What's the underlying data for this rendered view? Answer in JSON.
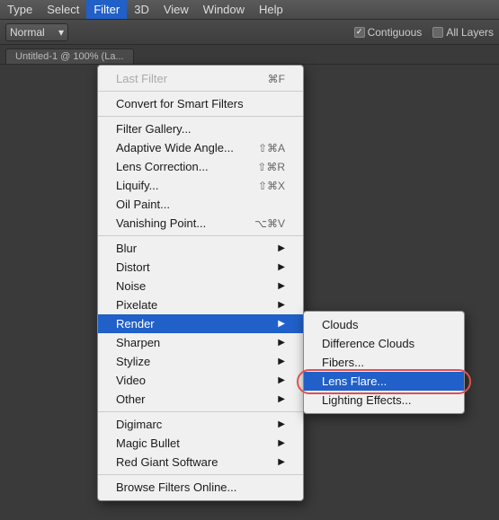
{
  "menubar": {
    "items": [
      {
        "label": "Type",
        "active": false
      },
      {
        "label": "Select",
        "active": false
      },
      {
        "label": "Filter",
        "active": true
      },
      {
        "label": "3D",
        "active": false
      },
      {
        "label": "View",
        "active": false
      },
      {
        "label": "Window",
        "active": false
      },
      {
        "label": "Help",
        "active": false
      }
    ]
  },
  "optionsbar": {
    "blend_mode": "Normal",
    "contiguous_label": "Contiguous",
    "all_layers_label": "All Layers"
  },
  "tab": {
    "label": "Untitled-1 @ 100% (La..."
  },
  "filter_menu": {
    "items": [
      {
        "label": "Last Filter",
        "shortcut": "⌘F",
        "disabled": true,
        "has_submenu": false
      },
      {
        "label": "",
        "separator": true
      },
      {
        "label": "Convert for Smart Filters",
        "shortcut": "",
        "disabled": false,
        "has_submenu": false
      },
      {
        "label": "",
        "separator": true
      },
      {
        "label": "Filter Gallery...",
        "shortcut": "",
        "disabled": false,
        "has_submenu": false
      },
      {
        "label": "Adaptive Wide Angle...",
        "shortcut": "⇧⌘A",
        "disabled": false,
        "has_submenu": false
      },
      {
        "label": "Lens Correction...",
        "shortcut": "⇧⌘R",
        "disabled": false,
        "has_submenu": false
      },
      {
        "label": "Liquify...",
        "shortcut": "⇧⌘X",
        "disabled": false,
        "has_submenu": false
      },
      {
        "label": "Oil Paint...",
        "shortcut": "",
        "disabled": false,
        "has_submenu": false
      },
      {
        "label": "Vanishing Point...",
        "shortcut": "⌥⌘V",
        "disabled": false,
        "has_submenu": false
      },
      {
        "label": "",
        "separator": true
      },
      {
        "label": "Blur",
        "shortcut": "",
        "disabled": false,
        "has_submenu": true
      },
      {
        "label": "Distort",
        "shortcut": "",
        "disabled": false,
        "has_submenu": true
      },
      {
        "label": "Noise",
        "shortcut": "",
        "disabled": false,
        "has_submenu": true
      },
      {
        "label": "Pixelate",
        "shortcut": "",
        "disabled": false,
        "has_submenu": true
      },
      {
        "label": "Render",
        "shortcut": "",
        "disabled": false,
        "has_submenu": true,
        "highlighted": true
      },
      {
        "label": "Sharpen",
        "shortcut": "",
        "disabled": false,
        "has_submenu": true
      },
      {
        "label": "Stylize",
        "shortcut": "",
        "disabled": false,
        "has_submenu": true
      },
      {
        "label": "Video",
        "shortcut": "",
        "disabled": false,
        "has_submenu": true
      },
      {
        "label": "Other",
        "shortcut": "",
        "disabled": false,
        "has_submenu": true
      },
      {
        "label": "",
        "separator": true
      },
      {
        "label": "Digimarc",
        "shortcut": "",
        "disabled": false,
        "has_submenu": true
      },
      {
        "label": "Magic Bullet",
        "shortcut": "",
        "disabled": false,
        "has_submenu": true
      },
      {
        "label": "Red Giant Software",
        "shortcut": "",
        "disabled": false,
        "has_submenu": true
      },
      {
        "label": "",
        "separator": true
      },
      {
        "label": "Browse Filters Online...",
        "shortcut": "",
        "disabled": false,
        "has_submenu": false
      }
    ]
  },
  "render_submenu": {
    "items": [
      {
        "label": "Clouds",
        "highlighted": false
      },
      {
        "label": "Difference Clouds",
        "highlighted": false
      },
      {
        "label": "Fibers...",
        "highlighted": false
      },
      {
        "label": "Lens Flare...",
        "highlighted": true
      },
      {
        "label": "Lighting Effects...",
        "highlighted": false
      }
    ]
  }
}
